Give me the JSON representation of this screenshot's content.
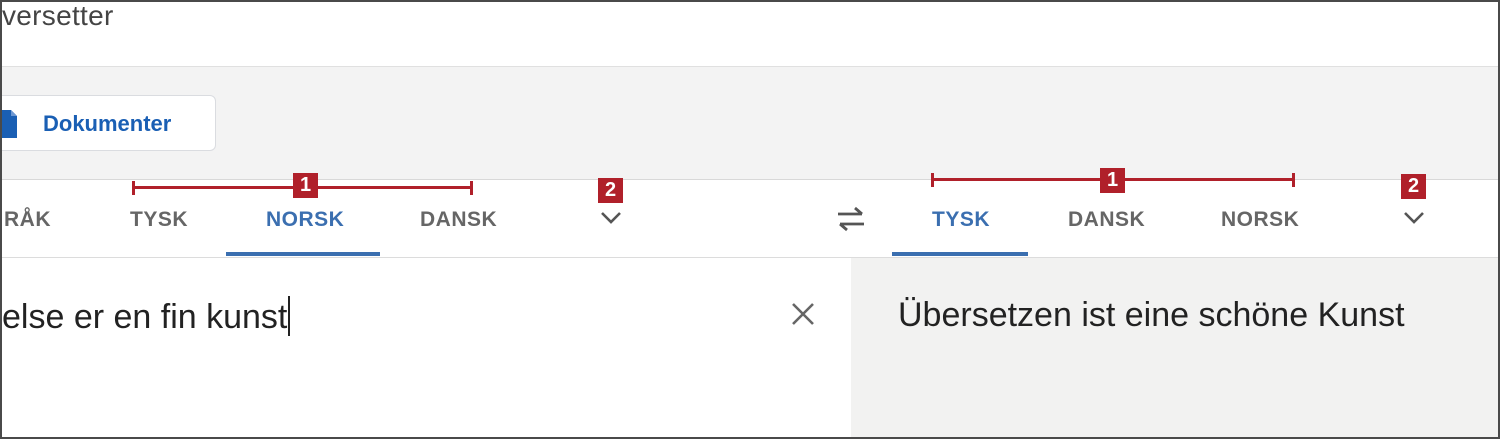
{
  "app": {
    "title": "versetter"
  },
  "toolbar": {
    "documents_label": "Dokumenter"
  },
  "source_languages": {
    "tabs": [
      {
        "label": "RÅK",
        "active": false
      },
      {
        "label": "TYSK",
        "active": false
      },
      {
        "label": "NORSK",
        "active": true
      },
      {
        "label": "DANSK",
        "active": false
      }
    ]
  },
  "target_languages": {
    "tabs": [
      {
        "label": "TYSK",
        "active": true
      },
      {
        "label": "DANSK",
        "active": false
      },
      {
        "label": "NORSK",
        "active": false
      }
    ]
  },
  "annotations": {
    "marker_1": "1",
    "marker_2": "2",
    "color": "#b0202a"
  },
  "source": {
    "text": "else er en fin kunst"
  },
  "target": {
    "text": "Übersetzen ist eine schöne Kunst"
  },
  "colors": {
    "accent": "#3b6fb0",
    "tab_inactive": "#666666",
    "target_bg": "#f2f2f1",
    "toolbar_bg": "#f3f3f3"
  },
  "icons": [
    "document-icon",
    "chevron-down-icon",
    "swap-languages-icon",
    "close-icon"
  ]
}
